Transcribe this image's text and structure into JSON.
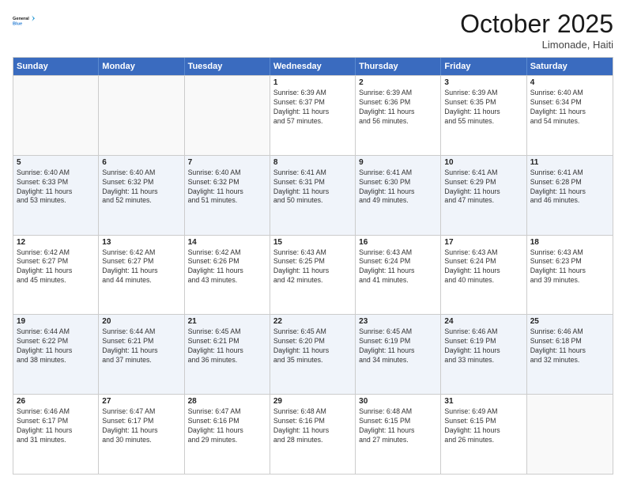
{
  "header": {
    "logo_line1": "General",
    "logo_line2": "Blue",
    "month": "October 2025",
    "location": "Limonade, Haiti"
  },
  "days": [
    "Sunday",
    "Monday",
    "Tuesday",
    "Wednesday",
    "Thursday",
    "Friday",
    "Saturday"
  ],
  "weeks": [
    [
      {
        "num": "",
        "lines": []
      },
      {
        "num": "",
        "lines": []
      },
      {
        "num": "",
        "lines": []
      },
      {
        "num": "1",
        "lines": [
          "Sunrise: 6:39 AM",
          "Sunset: 6:37 PM",
          "Daylight: 11 hours",
          "and 57 minutes."
        ]
      },
      {
        "num": "2",
        "lines": [
          "Sunrise: 6:39 AM",
          "Sunset: 6:36 PM",
          "Daylight: 11 hours",
          "and 56 minutes."
        ]
      },
      {
        "num": "3",
        "lines": [
          "Sunrise: 6:39 AM",
          "Sunset: 6:35 PM",
          "Daylight: 11 hours",
          "and 55 minutes."
        ]
      },
      {
        "num": "4",
        "lines": [
          "Sunrise: 6:40 AM",
          "Sunset: 6:34 PM",
          "Daylight: 11 hours",
          "and 54 minutes."
        ]
      }
    ],
    [
      {
        "num": "5",
        "lines": [
          "Sunrise: 6:40 AM",
          "Sunset: 6:33 PM",
          "Daylight: 11 hours",
          "and 53 minutes."
        ]
      },
      {
        "num": "6",
        "lines": [
          "Sunrise: 6:40 AM",
          "Sunset: 6:32 PM",
          "Daylight: 11 hours",
          "and 52 minutes."
        ]
      },
      {
        "num": "7",
        "lines": [
          "Sunrise: 6:40 AM",
          "Sunset: 6:32 PM",
          "Daylight: 11 hours",
          "and 51 minutes."
        ]
      },
      {
        "num": "8",
        "lines": [
          "Sunrise: 6:41 AM",
          "Sunset: 6:31 PM",
          "Daylight: 11 hours",
          "and 50 minutes."
        ]
      },
      {
        "num": "9",
        "lines": [
          "Sunrise: 6:41 AM",
          "Sunset: 6:30 PM",
          "Daylight: 11 hours",
          "and 49 minutes."
        ]
      },
      {
        "num": "10",
        "lines": [
          "Sunrise: 6:41 AM",
          "Sunset: 6:29 PM",
          "Daylight: 11 hours",
          "and 47 minutes."
        ]
      },
      {
        "num": "11",
        "lines": [
          "Sunrise: 6:41 AM",
          "Sunset: 6:28 PM",
          "Daylight: 11 hours",
          "and 46 minutes."
        ]
      }
    ],
    [
      {
        "num": "12",
        "lines": [
          "Sunrise: 6:42 AM",
          "Sunset: 6:27 PM",
          "Daylight: 11 hours",
          "and 45 minutes."
        ]
      },
      {
        "num": "13",
        "lines": [
          "Sunrise: 6:42 AM",
          "Sunset: 6:27 PM",
          "Daylight: 11 hours",
          "and 44 minutes."
        ]
      },
      {
        "num": "14",
        "lines": [
          "Sunrise: 6:42 AM",
          "Sunset: 6:26 PM",
          "Daylight: 11 hours",
          "and 43 minutes."
        ]
      },
      {
        "num": "15",
        "lines": [
          "Sunrise: 6:43 AM",
          "Sunset: 6:25 PM",
          "Daylight: 11 hours",
          "and 42 minutes."
        ]
      },
      {
        "num": "16",
        "lines": [
          "Sunrise: 6:43 AM",
          "Sunset: 6:24 PM",
          "Daylight: 11 hours",
          "and 41 minutes."
        ]
      },
      {
        "num": "17",
        "lines": [
          "Sunrise: 6:43 AM",
          "Sunset: 6:24 PM",
          "Daylight: 11 hours",
          "and 40 minutes."
        ]
      },
      {
        "num": "18",
        "lines": [
          "Sunrise: 6:43 AM",
          "Sunset: 6:23 PM",
          "Daylight: 11 hours",
          "and 39 minutes."
        ]
      }
    ],
    [
      {
        "num": "19",
        "lines": [
          "Sunrise: 6:44 AM",
          "Sunset: 6:22 PM",
          "Daylight: 11 hours",
          "and 38 minutes."
        ]
      },
      {
        "num": "20",
        "lines": [
          "Sunrise: 6:44 AM",
          "Sunset: 6:21 PM",
          "Daylight: 11 hours",
          "and 37 minutes."
        ]
      },
      {
        "num": "21",
        "lines": [
          "Sunrise: 6:45 AM",
          "Sunset: 6:21 PM",
          "Daylight: 11 hours",
          "and 36 minutes."
        ]
      },
      {
        "num": "22",
        "lines": [
          "Sunrise: 6:45 AM",
          "Sunset: 6:20 PM",
          "Daylight: 11 hours",
          "and 35 minutes."
        ]
      },
      {
        "num": "23",
        "lines": [
          "Sunrise: 6:45 AM",
          "Sunset: 6:19 PM",
          "Daylight: 11 hours",
          "and 34 minutes."
        ]
      },
      {
        "num": "24",
        "lines": [
          "Sunrise: 6:46 AM",
          "Sunset: 6:19 PM",
          "Daylight: 11 hours",
          "and 33 minutes."
        ]
      },
      {
        "num": "25",
        "lines": [
          "Sunrise: 6:46 AM",
          "Sunset: 6:18 PM",
          "Daylight: 11 hours",
          "and 32 minutes."
        ]
      }
    ],
    [
      {
        "num": "26",
        "lines": [
          "Sunrise: 6:46 AM",
          "Sunset: 6:17 PM",
          "Daylight: 11 hours",
          "and 31 minutes."
        ]
      },
      {
        "num": "27",
        "lines": [
          "Sunrise: 6:47 AM",
          "Sunset: 6:17 PM",
          "Daylight: 11 hours",
          "and 30 minutes."
        ]
      },
      {
        "num": "28",
        "lines": [
          "Sunrise: 6:47 AM",
          "Sunset: 6:16 PM",
          "Daylight: 11 hours",
          "and 29 minutes."
        ]
      },
      {
        "num": "29",
        "lines": [
          "Sunrise: 6:48 AM",
          "Sunset: 6:16 PM",
          "Daylight: 11 hours",
          "and 28 minutes."
        ]
      },
      {
        "num": "30",
        "lines": [
          "Sunrise: 6:48 AM",
          "Sunset: 6:15 PM",
          "Daylight: 11 hours",
          "and 27 minutes."
        ]
      },
      {
        "num": "31",
        "lines": [
          "Sunrise: 6:49 AM",
          "Sunset: 6:15 PM",
          "Daylight: 11 hours",
          "and 26 minutes."
        ]
      },
      {
        "num": "",
        "lines": []
      }
    ]
  ]
}
